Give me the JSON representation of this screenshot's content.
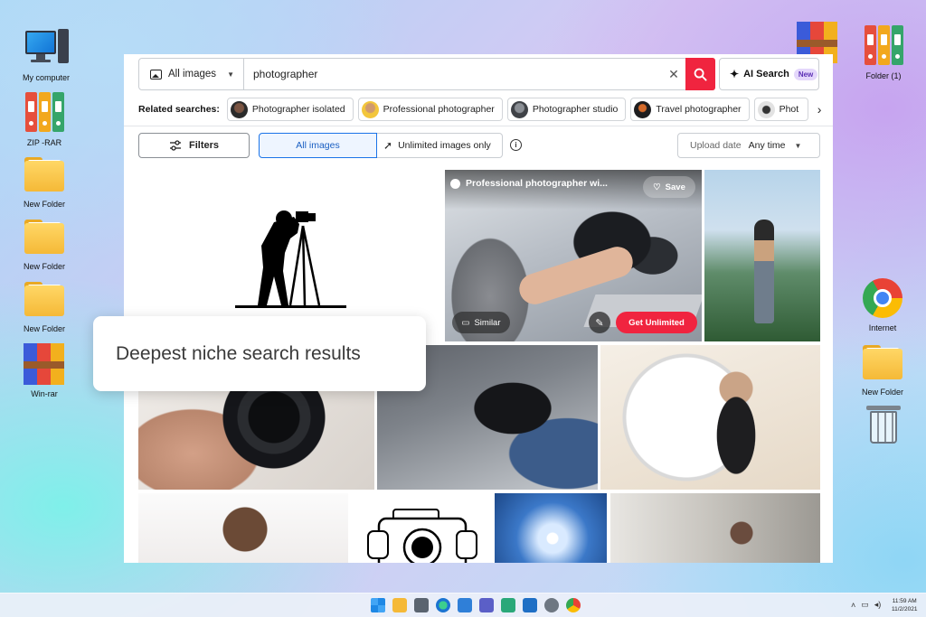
{
  "desktop": {
    "icons": {
      "my_computer": "My computer",
      "zip_rar": "ZIP -RAR",
      "new_folder_1": "New Folder",
      "new_folder_2": "New Folder",
      "new_folder_3": "New Folder",
      "win_rar": "Win-rar",
      "folder_1": "Folder (1)",
      "internet": "Internet",
      "new_folder_right": "New Folder"
    }
  },
  "search": {
    "type_label": "All images",
    "query": "photographer",
    "ai_label": "AI Search",
    "ai_badge": "New"
  },
  "related": {
    "label": "Related searches:",
    "chips": [
      "Photographer isolated",
      "Professional photographer",
      "Photographer studio",
      "Travel photographer",
      "Phot"
    ]
  },
  "filters": {
    "filters_label": "Filters",
    "all_images": "All images",
    "unlimited": "Unlimited images only",
    "sort_label": "Upload date",
    "sort_value": "Any time"
  },
  "feature_tile": {
    "title": "Professional photographer wi...",
    "save": "Save",
    "similar": "Similar",
    "get_unlimited": "Get Unlimited"
  },
  "callout": "Deepest niche search results",
  "taskbar": {
    "time": "11:59 AM",
    "date": "11/2/2021"
  },
  "colors": {
    "accent_red": "#f0243f",
    "accent_blue": "#1a73e8",
    "badge_purple": "#e4d7fb"
  }
}
